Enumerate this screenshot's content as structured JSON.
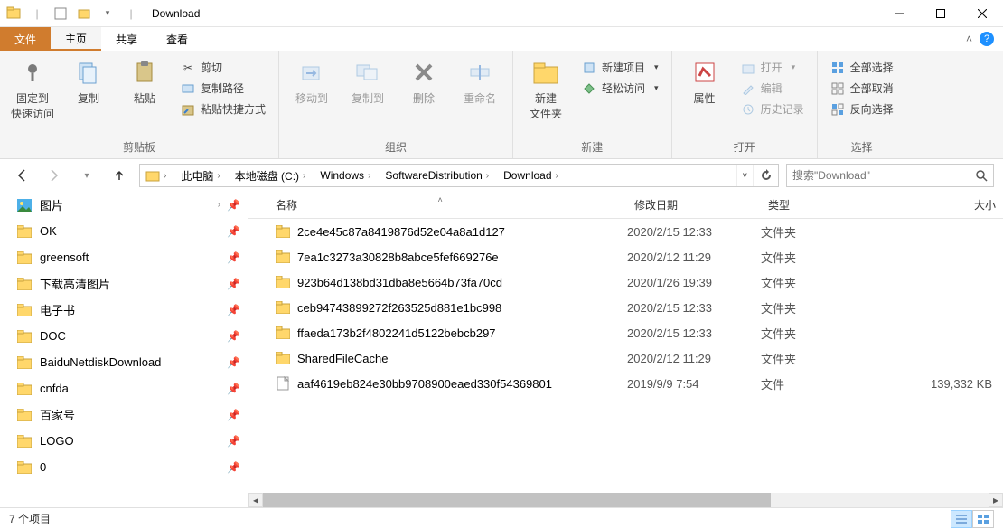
{
  "window": {
    "title": "Download"
  },
  "tabs": {
    "file": "文件",
    "home": "主页",
    "share": "共享",
    "view": "查看"
  },
  "ribbon": {
    "clipboard": {
      "label": "剪贴板",
      "pin": "固定到\n快速访问",
      "copy": "复制",
      "paste": "粘贴",
      "cut": "剪切",
      "copypath": "复制路径",
      "pasteshortcut": "粘贴快捷方式"
    },
    "organize": {
      "label": "组织",
      "moveto": "移动到",
      "copyto": "复制到",
      "delete": "删除",
      "rename": "重命名"
    },
    "new": {
      "label": "新建",
      "newfolder": "新建\n文件夹",
      "newitem": "新建项目",
      "easyaccess": "轻松访问"
    },
    "open": {
      "label": "打开",
      "properties": "属性",
      "open": "打开",
      "edit": "编辑",
      "history": "历史记录"
    },
    "select": {
      "label": "选择",
      "selectall": "全部选择",
      "selectnone": "全部取消",
      "invert": "反向选择"
    }
  },
  "breadcrumb": [
    "此电脑",
    "本地磁盘 (C:)",
    "Windows",
    "SoftwareDistribution",
    "Download"
  ],
  "search": {
    "placeholder": "搜索\"Download\""
  },
  "nav_items": [
    {
      "label": "图片",
      "icon": "pictures",
      "pin": true,
      "expand": true
    },
    {
      "label": "OK",
      "icon": "folder",
      "pin": true
    },
    {
      "label": "greensoft",
      "icon": "folder",
      "pin": true
    },
    {
      "label": "下载高清图片",
      "icon": "folder",
      "pin": true
    },
    {
      "label": "电子书",
      "icon": "folder",
      "pin": true
    },
    {
      "label": "DOC",
      "icon": "folder",
      "pin": true
    },
    {
      "label": "BaiduNetdiskDownload",
      "icon": "folder",
      "pin": true
    },
    {
      "label": "cnfda",
      "icon": "folder",
      "pin": true
    },
    {
      "label": "百家号",
      "icon": "folder",
      "pin": true
    },
    {
      "label": "LOGO",
      "icon": "folder",
      "pin": true
    },
    {
      "label": "0",
      "icon": "folder",
      "pin": true
    }
  ],
  "columns": {
    "name": "名称",
    "date": "修改日期",
    "type": "类型",
    "size": "大小"
  },
  "files": [
    {
      "name": "2ce4e45c87a8419876d52e04a8a1d127",
      "date": "2020/2/15 12:33",
      "type": "文件夹",
      "size": "",
      "icon": "folder"
    },
    {
      "name": "7ea1c3273a30828b8abce5fef669276e",
      "date": "2020/2/12 11:29",
      "type": "文件夹",
      "size": "",
      "icon": "folder"
    },
    {
      "name": "923b64d138bd31dba8e5664b73fa70cd",
      "date": "2020/1/26 19:39",
      "type": "文件夹",
      "size": "",
      "icon": "folder"
    },
    {
      "name": "ceb94743899272f263525d881e1bc998",
      "date": "2020/2/15 12:33",
      "type": "文件夹",
      "size": "",
      "icon": "folder"
    },
    {
      "name": "ffaeda173b2f4802241d5122bebcb297",
      "date": "2020/2/15 12:33",
      "type": "文件夹",
      "size": "",
      "icon": "folder"
    },
    {
      "name": "SharedFileCache",
      "date": "2020/2/12 11:29",
      "type": "文件夹",
      "size": "",
      "icon": "folder"
    },
    {
      "name": "aaf4619eb824e30bb9708900eaed330f54369801",
      "date": "2019/9/9 7:54",
      "type": "文件",
      "size": "139,332 KB",
      "icon": "file"
    }
  ],
  "status": {
    "count": "7 个项目"
  }
}
